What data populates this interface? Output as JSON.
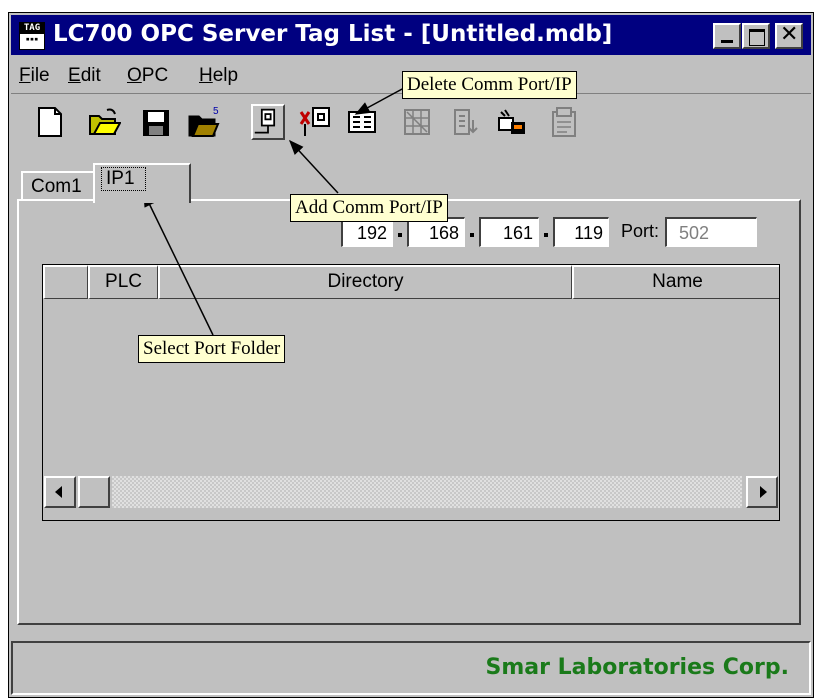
{
  "window": {
    "title": "LC700 OPC Server Tag List - [Untitled.mdb]",
    "app_icon_text": "TAG"
  },
  "menu": [
    {
      "label": "File",
      "mnemonic": "F",
      "rest": "ile"
    },
    {
      "label": "Edit",
      "mnemonic": "E",
      "rest": "dit"
    },
    {
      "label": "OPC",
      "mnemonic": "O",
      "rest": "PC"
    },
    {
      "label": "Help",
      "mnemonic": "H",
      "rest": "elp"
    }
  ],
  "toolbar": {
    "buttons": [
      "new-file-icon",
      "open-folder-icon",
      "save-disk-icon",
      "open-database-icon",
      "add-comm-port-icon",
      "delete-comm-port-icon",
      "list-view-icon",
      "grid-disabled-icon",
      "export-disabled-icon",
      "plc-config-icon",
      "tag-disabled-icon"
    ]
  },
  "tabs": [
    {
      "label": "Com1",
      "selected": false
    },
    {
      "label": "IP1",
      "selected": true
    }
  ],
  "ip": {
    "octet1": "192",
    "octet2": "168",
    "octet3": "161",
    "octet4": "119",
    "port_label": "Port:",
    "port_value": "502"
  },
  "grid": {
    "columns": [
      "",
      "PLC",
      "Directory",
      "Name"
    ]
  },
  "status": {
    "company": "Smar Laboratories Corp."
  },
  "callouts": {
    "delete": "Delete Comm Port/IP",
    "add": "Add Comm Port/IP",
    "select": "Select Port Folder"
  },
  "colors": {
    "titlebar": "#000080",
    "company_text": "#1a7a1a",
    "callout_bg": "#ffffd0"
  }
}
